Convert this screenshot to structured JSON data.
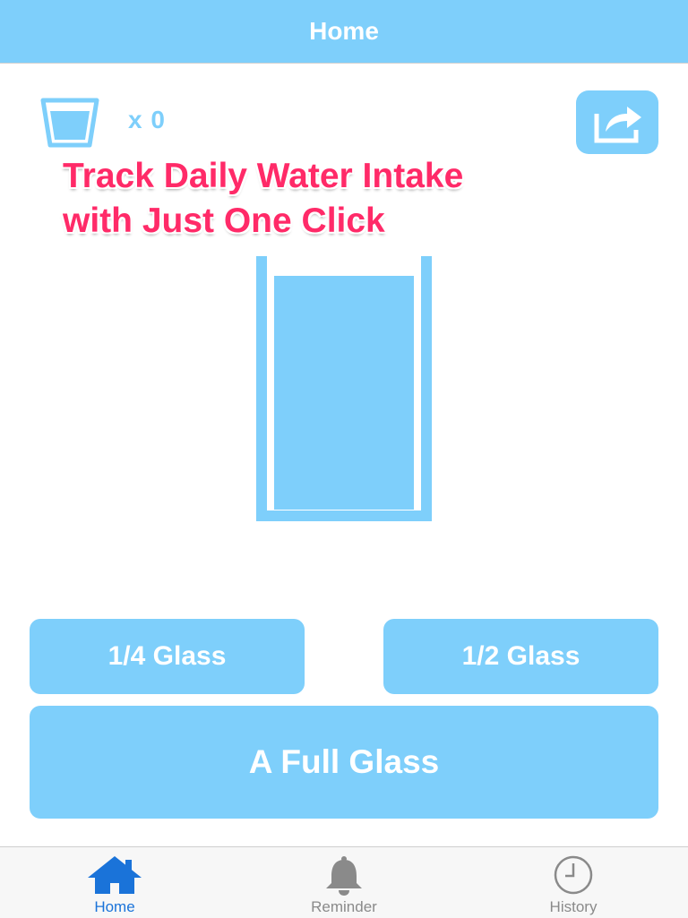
{
  "nav": {
    "title": "Home"
  },
  "counter": {
    "text": "x 0",
    "icon": "cup-icon"
  },
  "share": {
    "icon": "share-icon"
  },
  "promo": {
    "line1": "Track Daily Water Intake",
    "line2": "with Just One Click"
  },
  "glass": {
    "icon": "water-glass",
    "fill_level": 1.0
  },
  "buttons": {
    "quarter": "1/4 Glass",
    "half": "1/2 Glass",
    "full": "A Full Glass"
  },
  "tabs": [
    {
      "label": "Home",
      "icon": "home-icon",
      "active": true
    },
    {
      "label": "Reminder",
      "icon": "bell-icon",
      "active": false
    },
    {
      "label": "History",
      "icon": "clock-icon",
      "active": false
    }
  ],
  "colors": {
    "accent": "#7ecffb",
    "promo": "#ff2a68",
    "tab_active": "#1a73d9",
    "tab_inactive": "#8a8a8a"
  }
}
